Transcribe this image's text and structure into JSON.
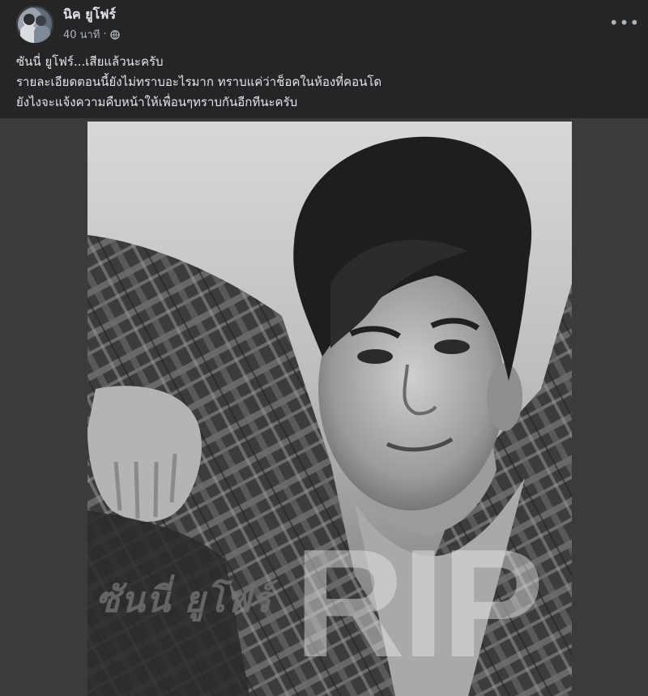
{
  "post": {
    "author": "นิค ยูโฟร์",
    "time": "40 นาที",
    "separator": "·",
    "privacy_icon": "globe-icon",
    "more_icon": "more-options-icon",
    "more_label": "•••",
    "text_lines": [
      "ซันนี่ ยูโฟร์...เสียแล้วนะครับ",
      "รายละเอียดตอนนี้ยังไม่ทราบอะไรมาก ทราบแค่ว่าช็อคในห้องที่คอนโด",
      "ยังไงจะแจ้งความคืบหน้าให้เพื่อนๆทราบกันอีกทีนะครับ"
    ]
  },
  "photo": {
    "overlay_name": "ซันนี่ ยูโฟร์",
    "overlay_rip": "RIP"
  },
  "colors": {
    "background": "#242526",
    "photo_frame": "#3a3b3c",
    "text_primary": "#e4e6eb",
    "text_secondary": "#b0b3b8"
  }
}
